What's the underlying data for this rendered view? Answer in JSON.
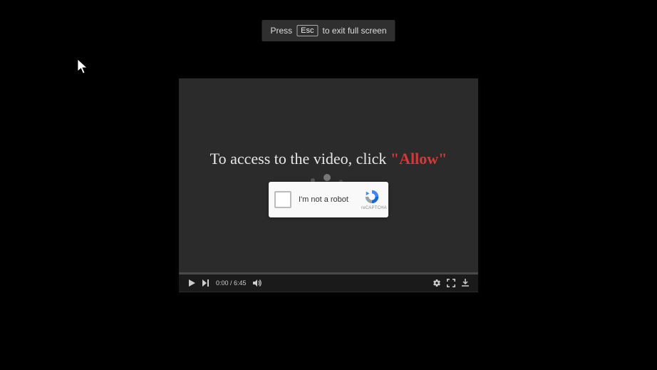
{
  "toast": {
    "prefix": "Press",
    "key": "Esc",
    "suffix": "to exit full screen"
  },
  "overlay": {
    "text_prefix": "To access to the video, click ",
    "allow": "\"Allow\""
  },
  "captcha": {
    "label": "I'm not a robot",
    "brand": "reCAPTCHA"
  },
  "player": {
    "time": "0:00 / 6:45"
  }
}
